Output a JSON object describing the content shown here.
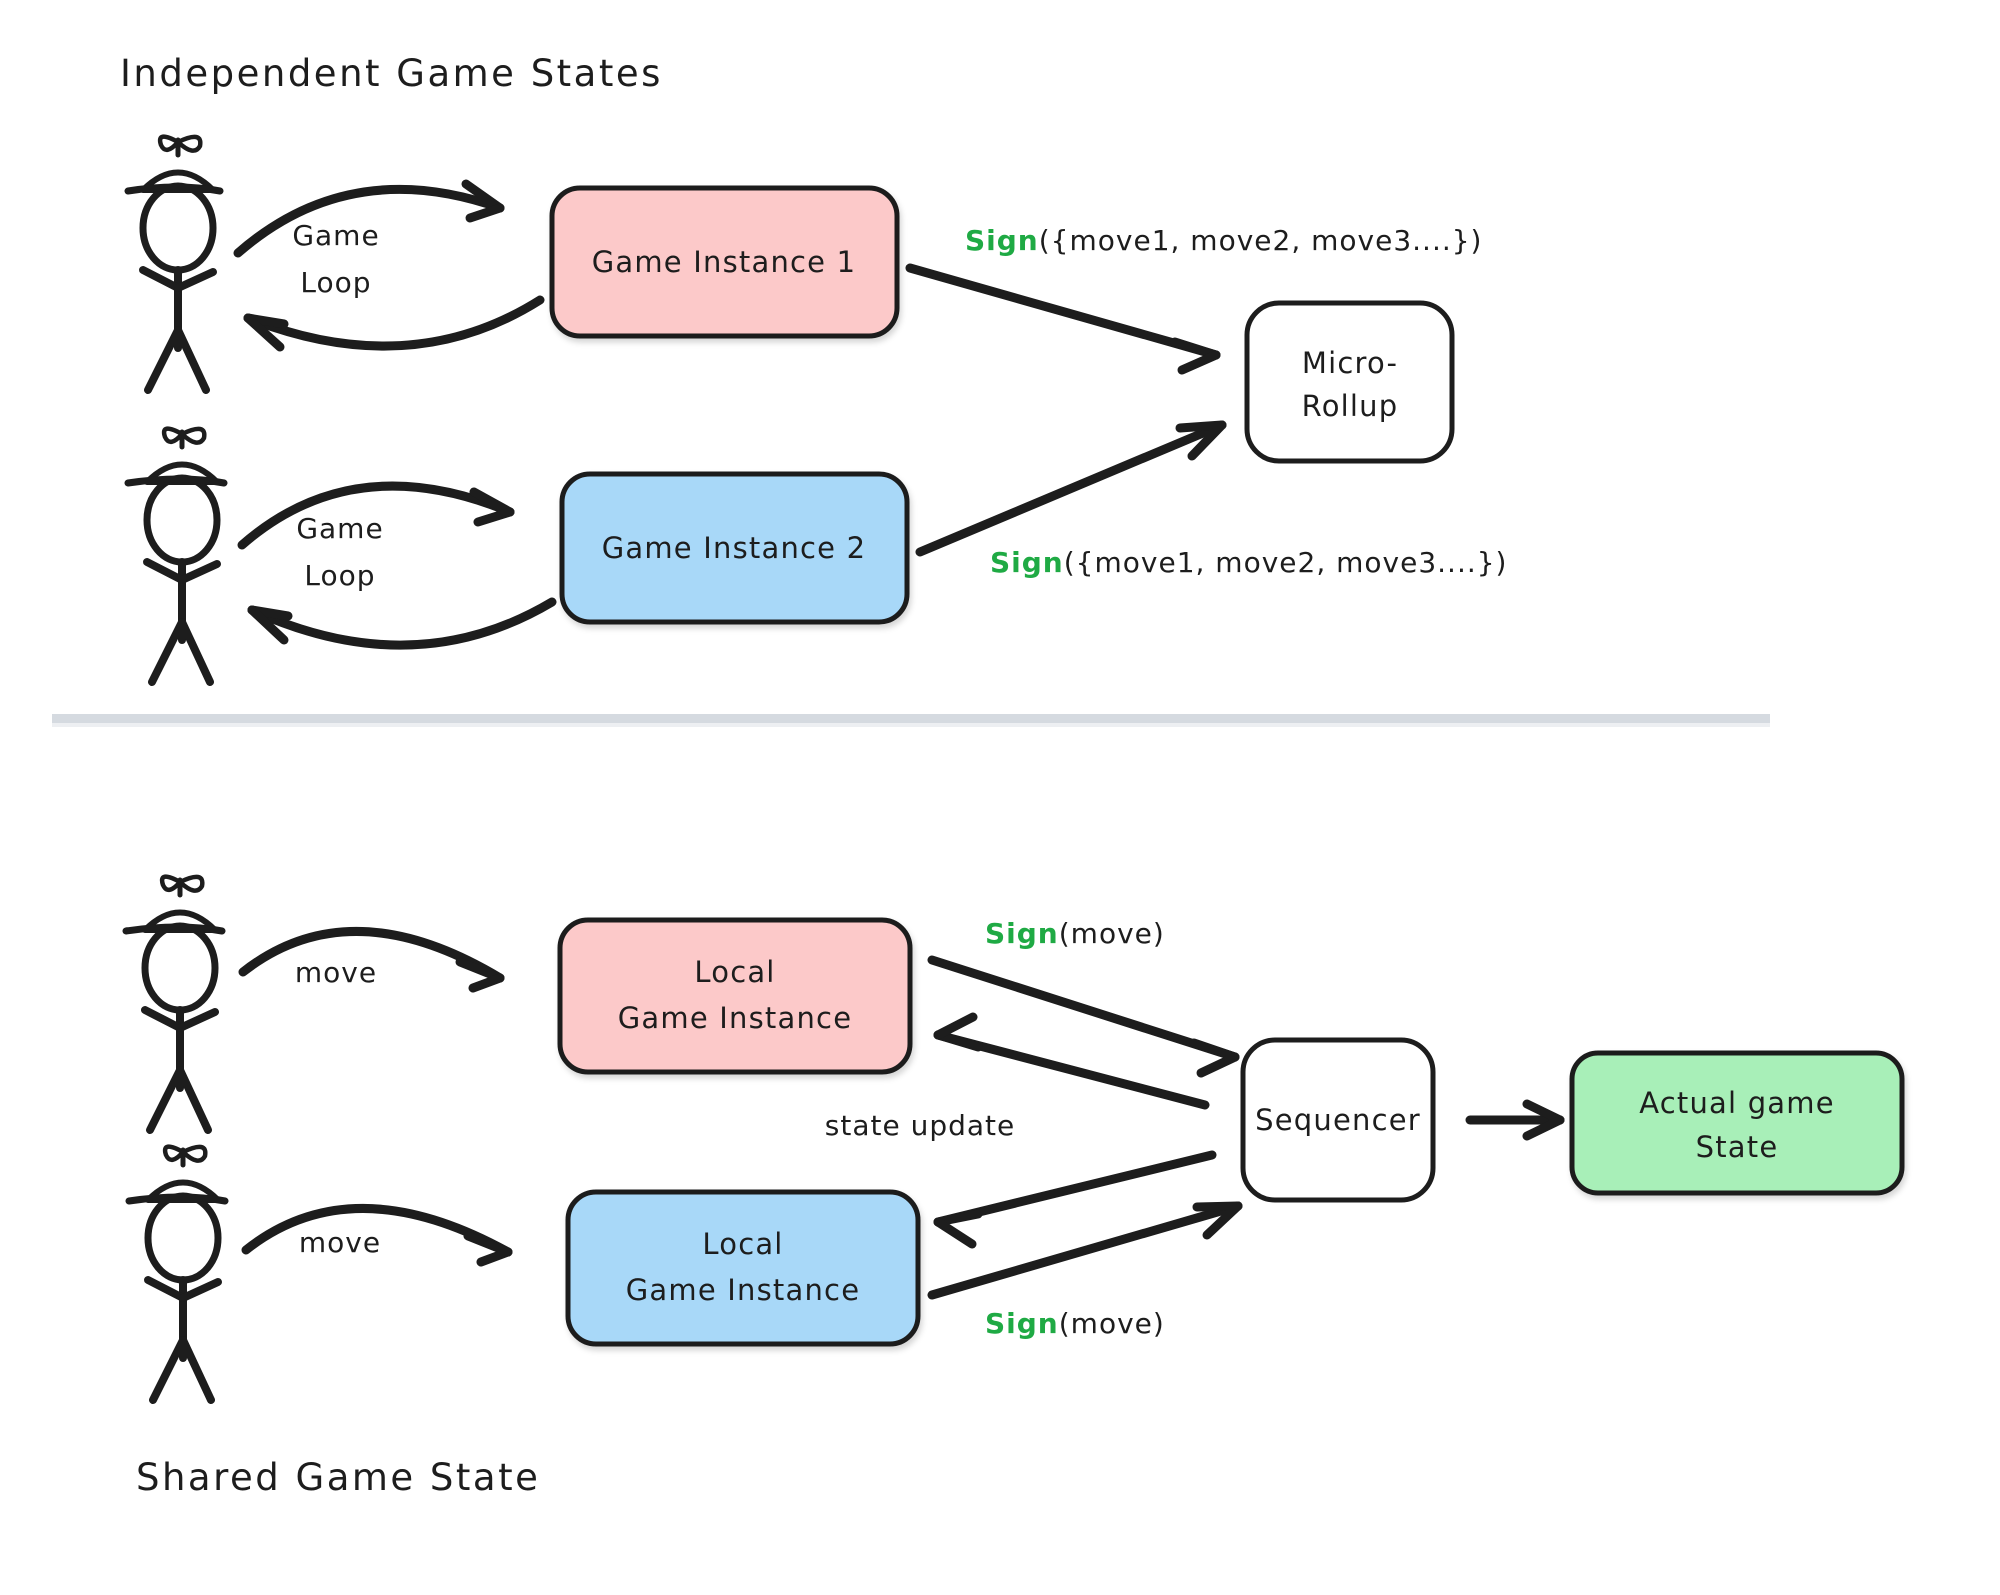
{
  "diagram": {
    "title_top": "Independent Game States",
    "title_bottom": "Shared Game State",
    "colors": {
      "pink": "#FCC9C9",
      "blue": "#A8D8F8",
      "green": "#A8EFB8",
      "white": "#FFFFFF",
      "stroke": "#1D1D1D",
      "sign_green": "#1FAA44",
      "hat_blue": "#3B5FE0",
      "hat_red": "#EE3B3B",
      "divider": "#D5DAE0"
    }
  },
  "top_section": {
    "title": "Independent Game States",
    "actors": [
      {
        "name": "player-one",
        "hat_color": "#3B5FE0"
      },
      {
        "name": "player-two",
        "hat_color": "#EE3B3B"
      }
    ],
    "loop_labels": [
      {
        "line1": "Game",
        "line2": "Loop"
      },
      {
        "line1": "Game",
        "line2": "Loop"
      }
    ],
    "instances": [
      {
        "label": "Game Instance 1",
        "fill": "#FCC9C9"
      },
      {
        "label": "Game Instance 2",
        "fill": "#A8D8F8"
      }
    ],
    "sign_labels": [
      {
        "green": "Sign",
        "black": "({move1, move2, move3....})"
      },
      {
        "green": "Sign",
        "black": "({move1, move2, move3....})"
      }
    ],
    "rollup": {
      "line1": "Micro-",
      "line2": "Rollup",
      "fill": "#FFFFFF"
    }
  },
  "bottom_section": {
    "title": "Shared Game State",
    "actors": [
      {
        "name": "player-one",
        "hat_color": "#3B5FE0"
      },
      {
        "name": "player-two",
        "hat_color": "#EE3B3B"
      }
    ],
    "move_labels": [
      "move",
      "move"
    ],
    "instances": [
      {
        "line1": "Local",
        "line2": "Game Instance",
        "fill": "#FCC9C9"
      },
      {
        "line1": "Local",
        "line2": "Game Instance",
        "fill": "#A8D8F8"
      }
    ],
    "sign_labels": [
      {
        "green": "Sign",
        "black": "(move)"
      },
      {
        "green": "Sign",
        "black": "(move)"
      }
    ],
    "state_update_label": "state update",
    "sequencer": {
      "label": "Sequencer",
      "fill": "#FFFFFF"
    },
    "actual_state": {
      "line1": "Actual game",
      "line2": "State",
      "fill": "#A8EFB8"
    }
  }
}
